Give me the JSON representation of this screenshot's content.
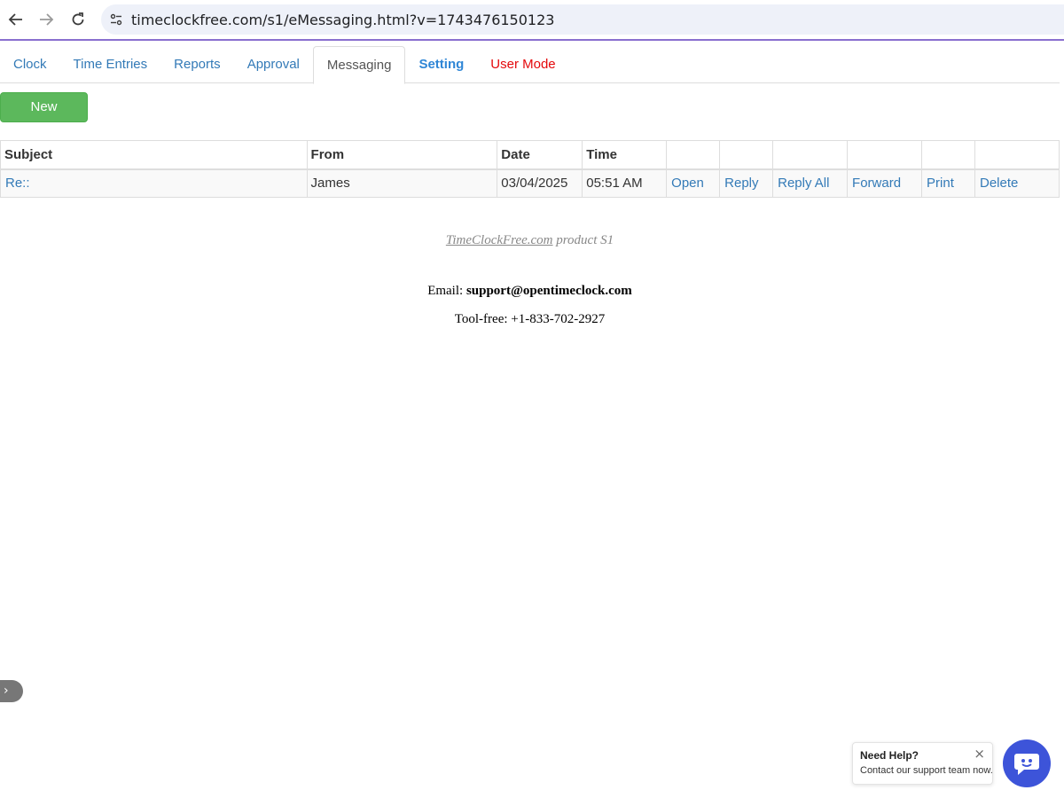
{
  "browser": {
    "url": "timeclockfree.com/s1/eMessaging.html?v=1743476150123",
    "back_icon": "arrow-left-icon",
    "forward_icon": "arrow-right-icon",
    "reload_icon": "reload-icon",
    "site_info_icon": "tune-icon"
  },
  "tabs": [
    {
      "label": "Clock"
    },
    {
      "label": "Time Entries"
    },
    {
      "label": "Reports"
    },
    {
      "label": "Approval"
    },
    {
      "label": "Messaging",
      "active": true
    },
    {
      "label": "Setting"
    },
    {
      "label": "User Mode"
    }
  ],
  "new_button_label": "New",
  "table": {
    "headers": [
      "Subject",
      "From",
      "Date",
      "Time",
      "",
      "",
      "",
      "",
      "",
      ""
    ],
    "rows": [
      {
        "subject": "Re::",
        "from": "James",
        "date": "03/04/2025",
        "time": "05:51 AM",
        "actions": [
          "Open",
          "Reply",
          "Reply All",
          "Forward",
          "Print",
          "Delete"
        ]
      }
    ]
  },
  "footer": {
    "product_link": "TimeClockFree.com",
    "product_suffix": " product S1",
    "email_label": "Email: ",
    "email": "support@opentimeclock.com",
    "phone": "Tool-free: +1-833-702-2927"
  },
  "side_toggle_icon": "chevron-right-icon",
  "help": {
    "title": "Need Help?",
    "subtitle": "Contact our support team now.",
    "close_icon": "close-icon",
    "chat_icon": "chat-icon"
  },
  "colors": {
    "link": "#337ab7",
    "new_button": "#5cb85c",
    "user_mode": "#e4090c",
    "chat_button": "#3d54d9"
  }
}
